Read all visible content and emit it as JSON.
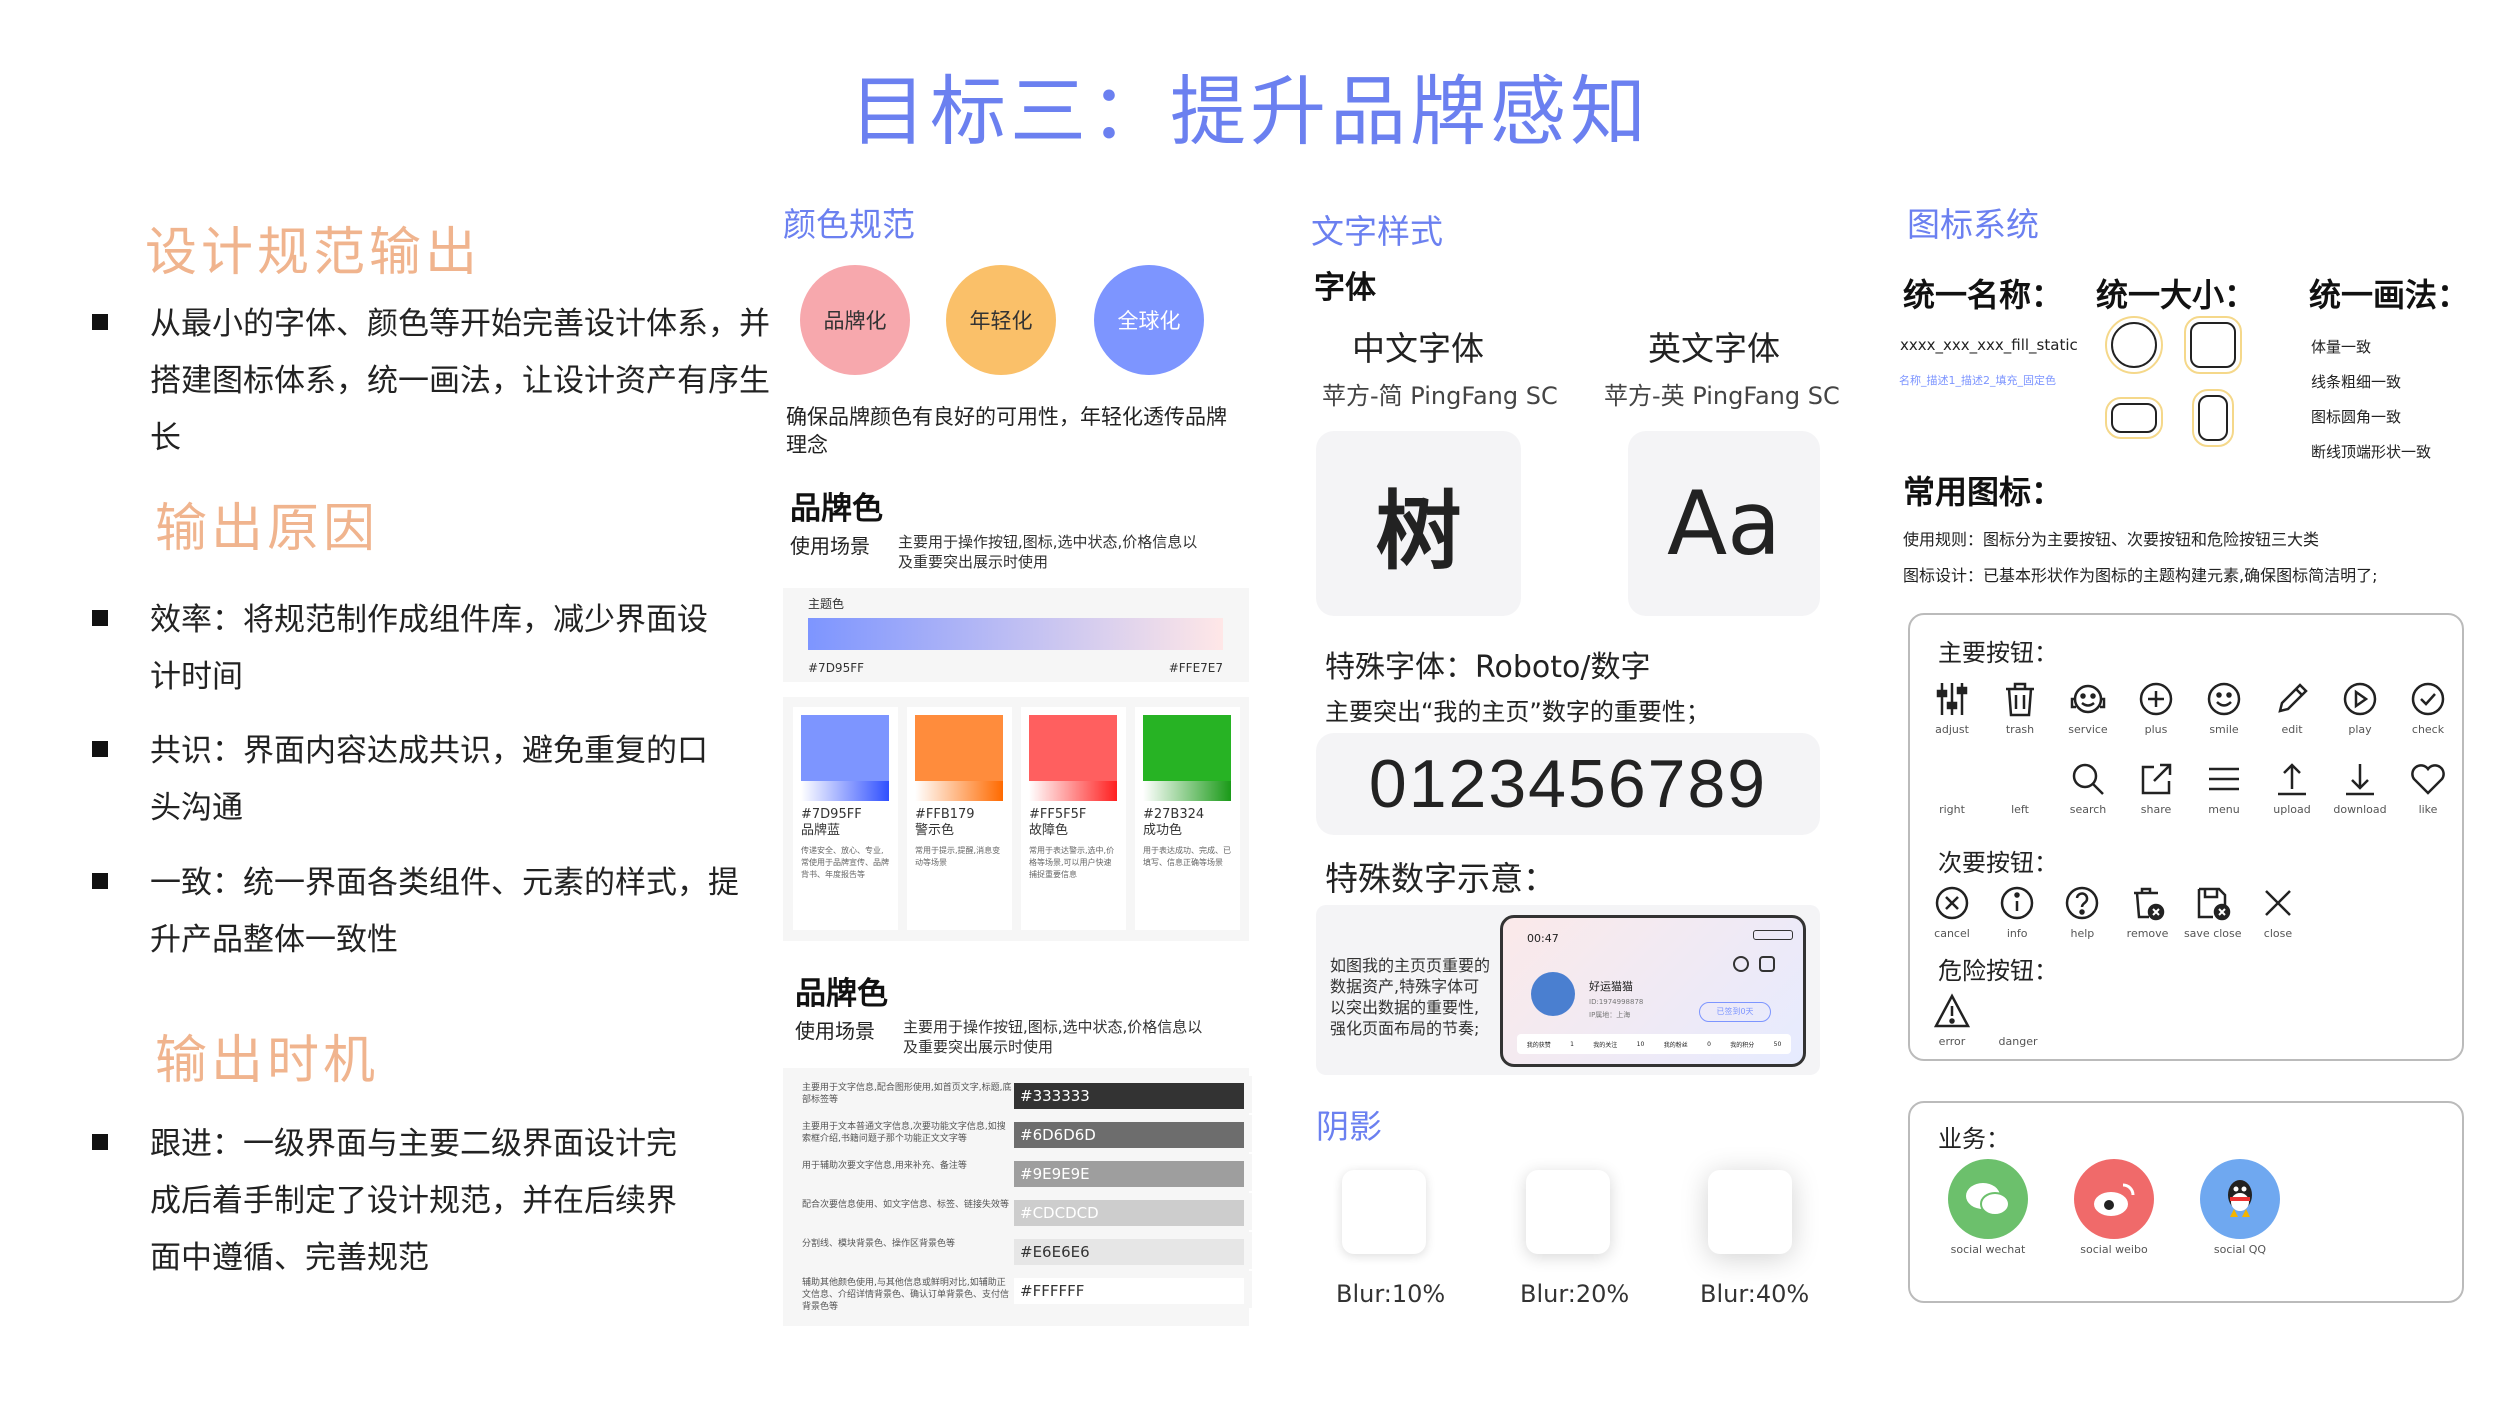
{
  "title": "目标三：提升品牌感知",
  "left": {
    "sec1_title": "设计规范输出",
    "sec1_text": "从最小的字体、颜色等开始完善设计体系，并搭建图标体系，统一画法，让设计资产有序生长",
    "sec2_title": "输出原因",
    "sec2_items": [
      "效率：将规范制作成组件库，减少界面设计时间",
      "共识：界面内容达成共识，避免重复的口头沟通",
      "一致：统一界面各类组件、元素的样式，提升产品整体一致性"
    ],
    "sec3_title": "输出时机",
    "sec3_text": "跟进：一级界面与主要二级界面设计完成后着手制定了设计规范，并在后续界面中遵循、完善规范"
  },
  "color": {
    "title": "颜色规范",
    "circles": [
      "品牌化",
      "年轻化",
      "全球化"
    ],
    "circle_colors": [
      "#f7a8ad",
      "#fac069",
      "#7d95ff"
    ],
    "desc": "确保品牌颜色有良好的可用性，年轻化透传品牌理念",
    "brand1_title": "品牌色",
    "scene_label": "使用场景",
    "scene_desc": "主要用于操作按钮,图标,选中状态,价格信息以及重要突出展示时使用",
    "gradient_label": "主题色",
    "gradient_start": "#7D95FF",
    "gradient_end": "#FFE7E7",
    "swatches": [
      {
        "hex": "#7D95FF",
        "name": "品牌蓝",
        "desc": "传递安全、放心、专业,常使用于品牌宣传、品牌背书、年度报告等"
      },
      {
        "hex": "#FFB179",
        "name": "警示色",
        "desc": "常用于提示,提醒,消息变动等场景"
      },
      {
        "hex": "#FF5F5F",
        "name": "故障色",
        "desc": "常用于表达警示,选中,价格等场景,可以用户快速捕捉重要信息"
      },
      {
        "hex": "#27B324",
        "name": "成功色",
        "desc": "用于表达成功、完成、已填写、信息正确等场景"
      }
    ],
    "swatch_display": [
      "#7d95ff",
      "#ff8c3c",
      "#ff5f5f",
      "#27b324"
    ],
    "brand2_title": "品牌色",
    "scene_label2": "使用场景",
    "scene_desc2": "主要用于操作按钮,图标,选中状态,价格信息以及重要突出展示时使用",
    "grays": [
      {
        "desc": "主要用于文字信息,配合图形使用,如首页文字,标题,底部标签等",
        "hex": "#333333",
        "text": "#ffffff"
      },
      {
        "desc": "主要用于文本普通文字信息,次要功能文字信息,如搜索框介绍,书籍问题子那个功能正文文字等",
        "hex": "#6D6D6D",
        "text": "#ffffff"
      },
      {
        "desc": "用于辅助次要文字信息,用来补充、备注等",
        "hex": "#9E9E9E",
        "text": "#ffffff"
      },
      {
        "desc": "配合次要信息使用、如文字信息、标签、链接失效等",
        "hex": "#CDCDCD",
        "text": "#ffffff"
      },
      {
        "desc": "分割线、模块背景色、操作区背景色等",
        "hex": "#E6E6E6",
        "text": "#333333"
      },
      {
        "desc": "辅助其他颜色使用,与其他信息或鲜明对比,如辅助正文信息、介绍详情背景色、确认订单背景色、支付信背景色等",
        "hex": "#FFFFFF",
        "text": "#333333"
      }
    ]
  },
  "text": {
    "title": "文字样式",
    "font_heading": "字体",
    "cn_font": "中文字体",
    "en_font": "英文字体",
    "cn_font_name": "苹方-简 PingFang SC",
    "en_font_name": "苹方-英 PingFang SC",
    "cn_sample": "树",
    "en_sample": "Aa",
    "special_font": "特殊字体：Roboto/数字",
    "special_desc": "主要突出“我的主页”数字的重要性；",
    "digits": "0123456789",
    "digits_heading": "特殊数字示意：",
    "phone_desc": "如图我的主页页重要的数据资产,特殊字体可以突出数据的重要性,强化页面布局的节奏;",
    "phone_time": "00:47",
    "phone_user": "好运猫猫",
    "phone_id": "ID:1974998878",
    "phone_loc": "IP属地：上海",
    "phone_tag": "已签到0天",
    "phone_stats": [
      "我的获赞",
      "1",
      "我的关注",
      "10",
      "我的粉丝",
      "0",
      "我的积分",
      "50"
    ],
    "shadow_title": "阴影",
    "blurs": [
      "Blur:10%",
      "Blur:20%",
      "Blur:40%"
    ]
  },
  "icons": {
    "title": "图标系统",
    "naming_title": "统一名称：",
    "naming_value": "xxxx_xxx_xxx_fill_static",
    "naming_sub": "名称_描述1_描述2_填充_固定色",
    "size_title": "统一大小：",
    "style_title": "统一画法：",
    "style_rules": [
      "体量一致",
      "线条粗细一致",
      "图标圆角一致",
      "断线顶端形状一致"
    ],
    "common_title": "常用图标：",
    "rule1": "使用规则：图标分为主要按钮、次要按钮和危险按钮三大类",
    "rule2": "图标设计：已基本形状作为图标的主题构建元素,确保图标简洁明了;",
    "primary_title": "主要按钮：",
    "primary_row1": [
      "adjust",
      "trash",
      "service",
      "plus",
      "smile",
      "edit",
      "play",
      "check"
    ],
    "primary_row2": [
      "right",
      "left",
      "search",
      "share",
      "menu",
      "upload",
      "download",
      "like"
    ],
    "secondary_title": "次要按钮：",
    "secondary": [
      "cancel",
      "info",
      "help",
      "remove",
      "save close",
      "close"
    ],
    "danger_title": "危险按钮：",
    "danger": [
      "error",
      "danger"
    ],
    "business_title": "业务：",
    "business": [
      "social wechat",
      "social weibo",
      "social QQ"
    ],
    "business_colors": [
      "#6cc06c",
      "#f06a6a",
      "#6fa8f0"
    ]
  }
}
